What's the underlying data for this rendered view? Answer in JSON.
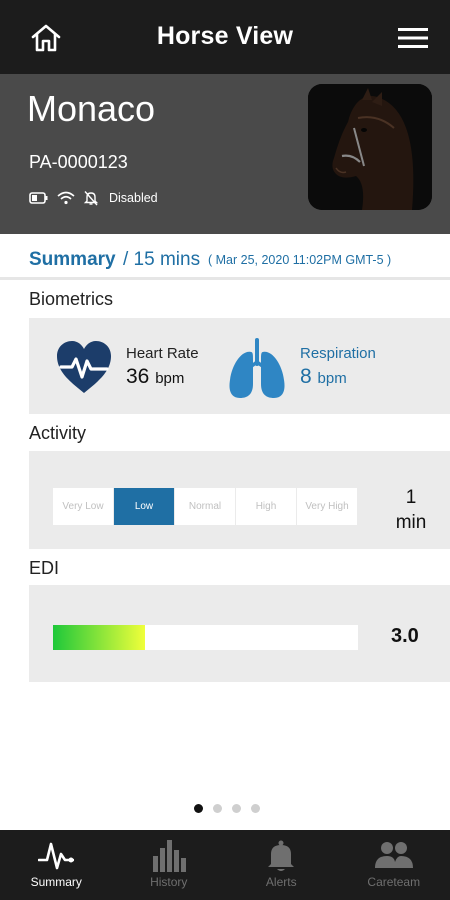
{
  "topbar": {
    "title": "Horse View"
  },
  "horse": {
    "name": "Monaco",
    "id": "PA-0000123",
    "notification_status": "Disabled"
  },
  "summary": {
    "label": "Summary",
    "duration": "/ 15 mins",
    "timestamp": "( Mar 25, 2020 11:02PM GMT-5 )"
  },
  "biometrics": {
    "title": "Biometrics",
    "heart_rate": {
      "label": "Heart Rate",
      "value": "36",
      "unit": "bpm"
    },
    "respiration": {
      "label": "Respiration",
      "value": "8",
      "unit": "bpm"
    }
  },
  "activity": {
    "title": "Activity",
    "levels": [
      "Very Low",
      "Low",
      "Normal",
      "High",
      "Very High"
    ],
    "selected": "Low",
    "value": "1",
    "unit": "min"
  },
  "edi": {
    "title": "EDI",
    "value": "3.0",
    "fill_fraction": 0.3
  },
  "pager": {
    "count": 4,
    "active": 0
  },
  "tabs": [
    {
      "label": "Summary",
      "active": true
    },
    {
      "label": "History",
      "active": false
    },
    {
      "label": "Alerts",
      "active": false
    },
    {
      "label": "Careteam",
      "active": false
    }
  ],
  "colors": {
    "accent": "#1f6fa4",
    "heart_icon": "#1c3d6a",
    "lungs_icon": "#2f86c4",
    "topbar": "#1c1c1c",
    "header": "#4a4a4a",
    "edi_gradient_start": "#1ec83a",
    "edi_gradient_end": "#f0ff3a"
  },
  "icons": [
    "home-icon",
    "menu-icon",
    "battery-icon",
    "wifi-icon",
    "bell-off-icon",
    "heart-rate-icon",
    "lungs-icon",
    "pulse-icon",
    "bar-chart-icon",
    "bell-icon",
    "people-icon"
  ]
}
